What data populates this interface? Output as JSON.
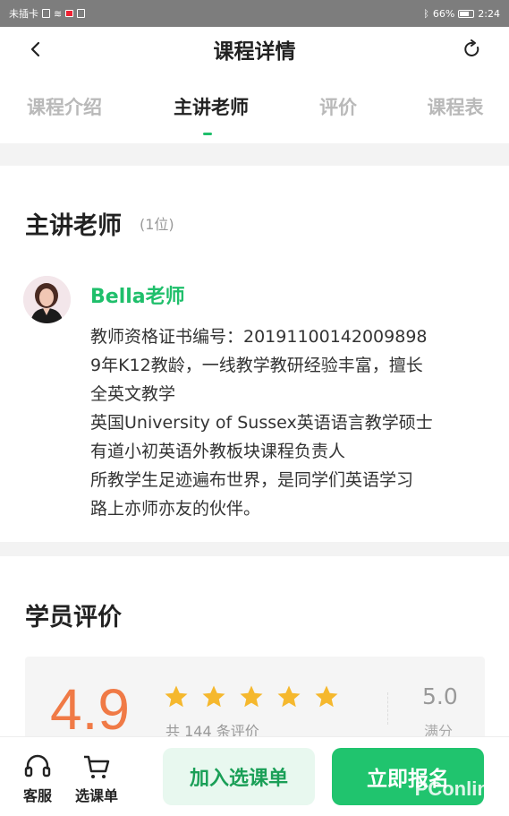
{
  "status_bar": {
    "left_text": "未插卡",
    "battery": "66%",
    "time": "2:24"
  },
  "header": {
    "title": "课程详情",
    "back_icon": "chevron-left-icon",
    "refresh_icon": "refresh-icon"
  },
  "tabs": [
    {
      "label": "课程介绍",
      "active": false
    },
    {
      "label": "主讲老师",
      "active": true
    },
    {
      "label": "评价",
      "active": false
    },
    {
      "label": "课程表",
      "active": false
    }
  ],
  "teacher_section": {
    "title": "主讲老师",
    "count": "(1位)",
    "teacher": {
      "name": "Bella老师",
      "lines": [
        "教师资格证书编号：20191100142009898",
        "9年K12教龄，一线教学教研经验丰富，擅长",
        "全英文教学",
        "英国University of Sussex英语语言教学硕士",
        "有道小初英语外教板块课程负责人",
        "所教学生足迹遍布世界，是同学们英语学习",
        "路上亦师亦友的伙伴。"
      ]
    }
  },
  "reviews_section": {
    "title": "学员评价",
    "score": "4.9",
    "stars": 5,
    "review_count": "共 144 条评价",
    "full_score": "5.0",
    "full_label": "满分"
  },
  "bottom_bar": {
    "service_label": "客服",
    "cart_label": "选课单",
    "add_cart_button": "加入选课单",
    "enroll_button": "立即报名"
  },
  "watermark": "PConline",
  "colors": {
    "accent_green": "#1fbf6b",
    "score_orange": "#f07a46",
    "star_yellow": "#f5b82e"
  }
}
